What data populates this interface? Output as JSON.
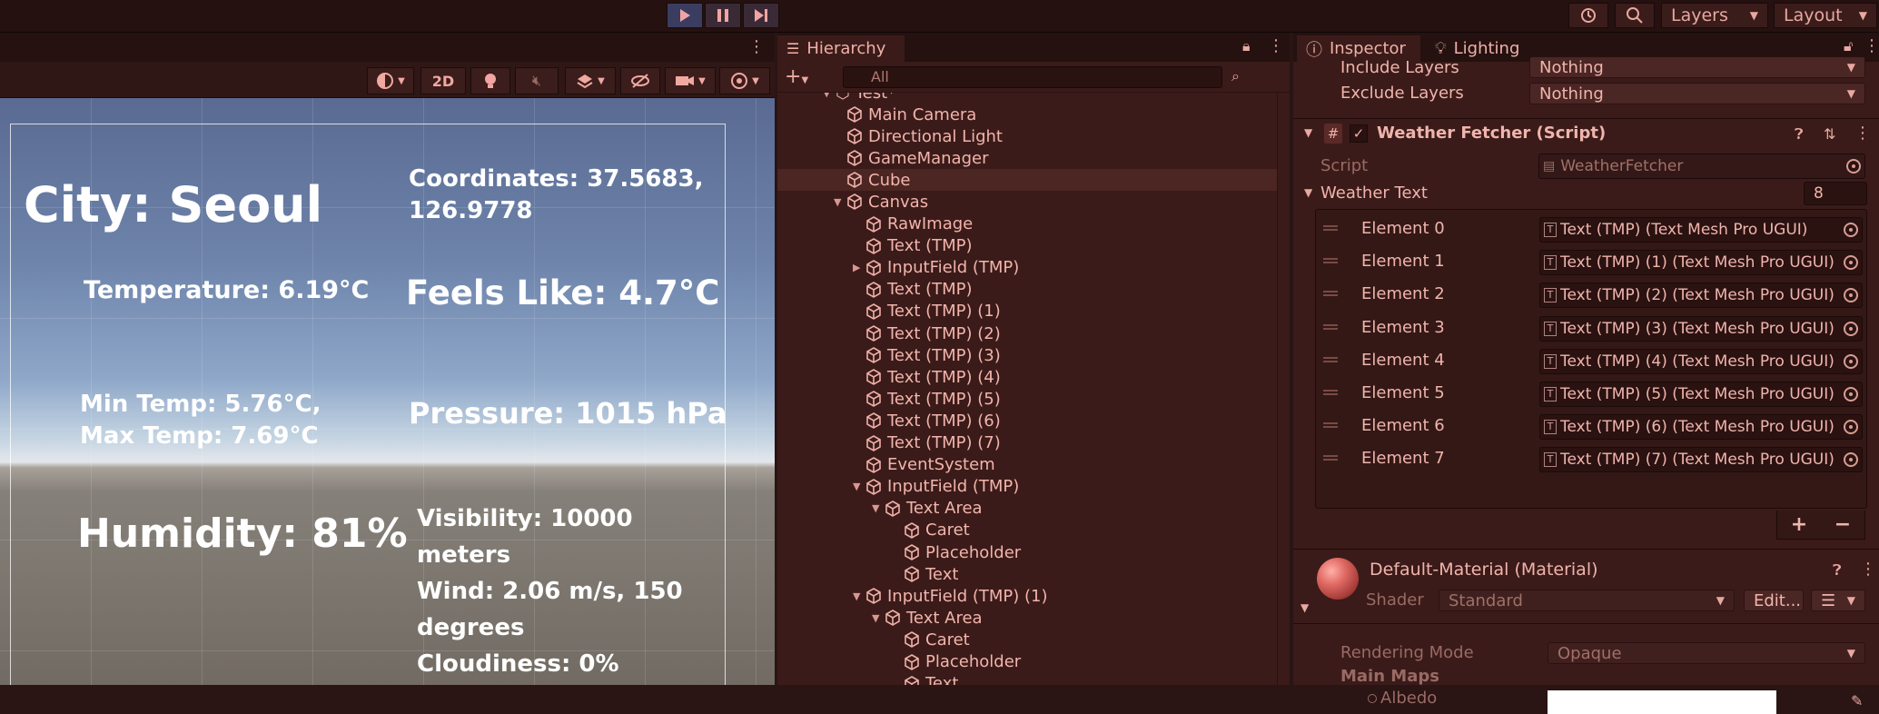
{
  "toolbar": {
    "play_icon": "play-icon",
    "pause_icon": "pause-icon",
    "step_icon": "step-icon",
    "layers_label": "Layers",
    "layout_label": "Layout"
  },
  "scene": {
    "mode_2d": "2D"
  },
  "game_ui": {
    "city": "City: Seoul",
    "coordinates": "Coordinates: 37.5683, 126.9778",
    "temperature": "Temperature: 6.19°C",
    "feels_like": "Feels Like: 4.7°C",
    "min_max": "Min Temp: 5.76°C, Max Temp: 7.69°C",
    "pressure": "Pressure: 1015 hPa",
    "humidity": "Humidity: 81%",
    "visibility": "Visibility: 10000 meters",
    "wind": "Wind: 2.06 m/s, 150 degrees",
    "cloudiness": "Cloudiness: 0%"
  },
  "hierarchy": {
    "tab_label": "Hierarchy",
    "search_placeholder": "All",
    "scene_name": "Test*",
    "items": [
      {
        "label": "Main Camera",
        "depth": 1,
        "fold": ""
      },
      {
        "label": "Directional Light",
        "depth": 1,
        "fold": ""
      },
      {
        "label": "GameManager",
        "depth": 1,
        "fold": ""
      },
      {
        "label": "Cube",
        "depth": 1,
        "fold": "",
        "selected": true
      },
      {
        "label": "Canvas",
        "depth": 1,
        "fold": "▼"
      },
      {
        "label": "RawImage",
        "depth": 2,
        "fold": ""
      },
      {
        "label": "Text (TMP)",
        "depth": 2,
        "fold": ""
      },
      {
        "label": "InputField (TMP)",
        "depth": 2,
        "fold": "▶"
      },
      {
        "label": "Text (TMP)",
        "depth": 2,
        "fold": ""
      },
      {
        "label": "Text (TMP) (1)",
        "depth": 2,
        "fold": ""
      },
      {
        "label": "Text (TMP) (2)",
        "depth": 2,
        "fold": ""
      },
      {
        "label": "Text (TMP) (3)",
        "depth": 2,
        "fold": ""
      },
      {
        "label": "Text (TMP) (4)",
        "depth": 2,
        "fold": ""
      },
      {
        "label": "Text (TMP) (5)",
        "depth": 2,
        "fold": ""
      },
      {
        "label": "Text (TMP) (6)",
        "depth": 2,
        "fold": ""
      },
      {
        "label": "Text (TMP) (7)",
        "depth": 2,
        "fold": ""
      },
      {
        "label": "EventSystem",
        "depth": 2,
        "fold": ""
      },
      {
        "label": "InputField (TMP)",
        "depth": 2,
        "fold": "▼"
      },
      {
        "label": "Text Area",
        "depth": 3,
        "fold": "▼"
      },
      {
        "label": "Caret",
        "depth": 4,
        "fold": ""
      },
      {
        "label": "Placeholder",
        "depth": 4,
        "fold": ""
      },
      {
        "label": "Text",
        "depth": 4,
        "fold": ""
      },
      {
        "label": "InputField (TMP) (1)",
        "depth": 2,
        "fold": "▼"
      },
      {
        "label": "Text Area",
        "depth": 3,
        "fold": "▼"
      },
      {
        "label": "Caret",
        "depth": 4,
        "fold": ""
      },
      {
        "label": "Placeholder",
        "depth": 4,
        "fold": ""
      },
      {
        "label": "Text",
        "depth": 4,
        "fold": ""
      }
    ]
  },
  "inspector": {
    "tab_inspector": "Inspector",
    "tab_lighting": "Lighting",
    "include_layers_label": "Include Layers",
    "include_layers_value": "Nothing",
    "exclude_layers_label": "Exclude Layers",
    "exclude_layers_value": "Nothing",
    "component_title": "Weather Fetcher (Script)",
    "script_label": "Script",
    "script_value": "WeatherFetcher",
    "weather_text_label": "Weather Text",
    "weather_text_size": "8",
    "elements": [
      {
        "label": "Element 0",
        "value": "Text (TMP) (Text Mesh Pro UGUI)"
      },
      {
        "label": "Element 1",
        "value": "Text (TMP) (1) (Text Mesh Pro UGUI)"
      },
      {
        "label": "Element 2",
        "value": "Text (TMP) (2) (Text Mesh Pro UGUI)"
      },
      {
        "label": "Element 3",
        "value": "Text (TMP) (3) (Text Mesh Pro UGUI)"
      },
      {
        "label": "Element 4",
        "value": "Text (TMP) (4) (Text Mesh Pro UGUI)"
      },
      {
        "label": "Element 5",
        "value": "Text (TMP) (5) (Text Mesh Pro UGUI)"
      },
      {
        "label": "Element 6",
        "value": "Text (TMP) (6) (Text Mesh Pro UGUI)"
      },
      {
        "label": "Element 7",
        "value": "Text (TMP) (7) (Text Mesh Pro UGUI)"
      }
    ],
    "add_label": "+",
    "remove_label": "−",
    "material_title": "Default-Material (Material)",
    "shader_label": "Shader",
    "shader_value": "Standard",
    "edit_label": "Edit...",
    "rendering_mode_label": "Rendering Mode",
    "rendering_mode_value": "Opaque",
    "main_maps_label": "Main Maps",
    "albedo_label": "Albedo"
  },
  "colors": {
    "editor_tint": "#3a1b19",
    "text": "#f0b4ac",
    "play_active": "#3b3d60"
  }
}
